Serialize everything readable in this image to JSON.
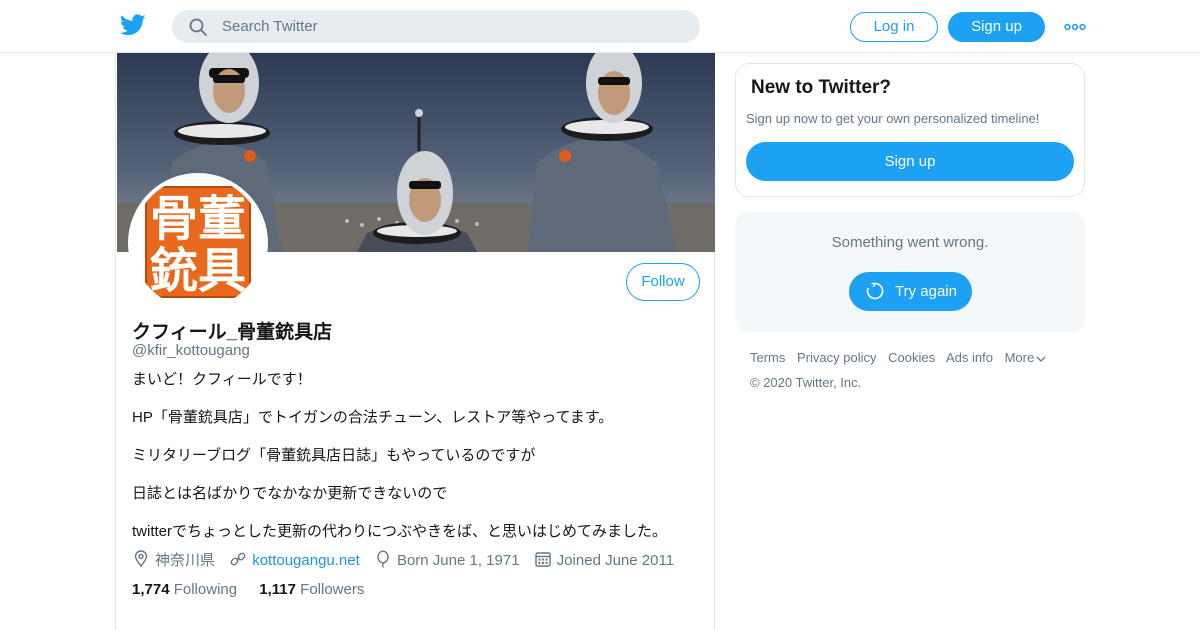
{
  "header": {
    "logo_icon": "twitter-bird-icon",
    "search_placeholder": "Search Twitter",
    "login_label": "Log in",
    "signup_label": "Sign up",
    "more_icon": "more-dots-icon",
    "brand_color": "#1da1f2"
  },
  "profile": {
    "avatar_text": [
      "骨",
      "董",
      "銃",
      "具"
    ],
    "follow_label": "Follow",
    "name": "クフィール_骨董銃具店",
    "handle": "@kfir_kottougang",
    "bio": [
      "まいど！クフィールです！",
      "HP「骨董銃具店」でトイガンの合法チューン、レストア等やってます。",
      "ミリタリーブログ「骨董銃具店日誌」もやっているのですが",
      "日誌とは名ばかりでなかなか更新できないので",
      "twitterでちょっとした更新の代わりにつぶやきをば、と思いはじめてみました。"
    ],
    "location": "神奈川県",
    "website": "kottougangu.net",
    "birthday": "Born June 1, 1971",
    "joined": "Joined June 2011",
    "following_count": "1,774",
    "following_label": "Following",
    "followers_count": "1,117",
    "followers_label": "Followers"
  },
  "sidebar": {
    "new_title": "New to Twitter?",
    "new_subtitle": "Sign up now to get your own personalized timeline!",
    "new_signup_label": "Sign up",
    "error_message": "Something went wrong.",
    "retry_label": "Try again"
  },
  "footer": {
    "links": [
      "Terms",
      "Privacy policy",
      "Cookies",
      "Ads info",
      "More"
    ],
    "copyright": "© 2020 Twitter, Inc."
  }
}
